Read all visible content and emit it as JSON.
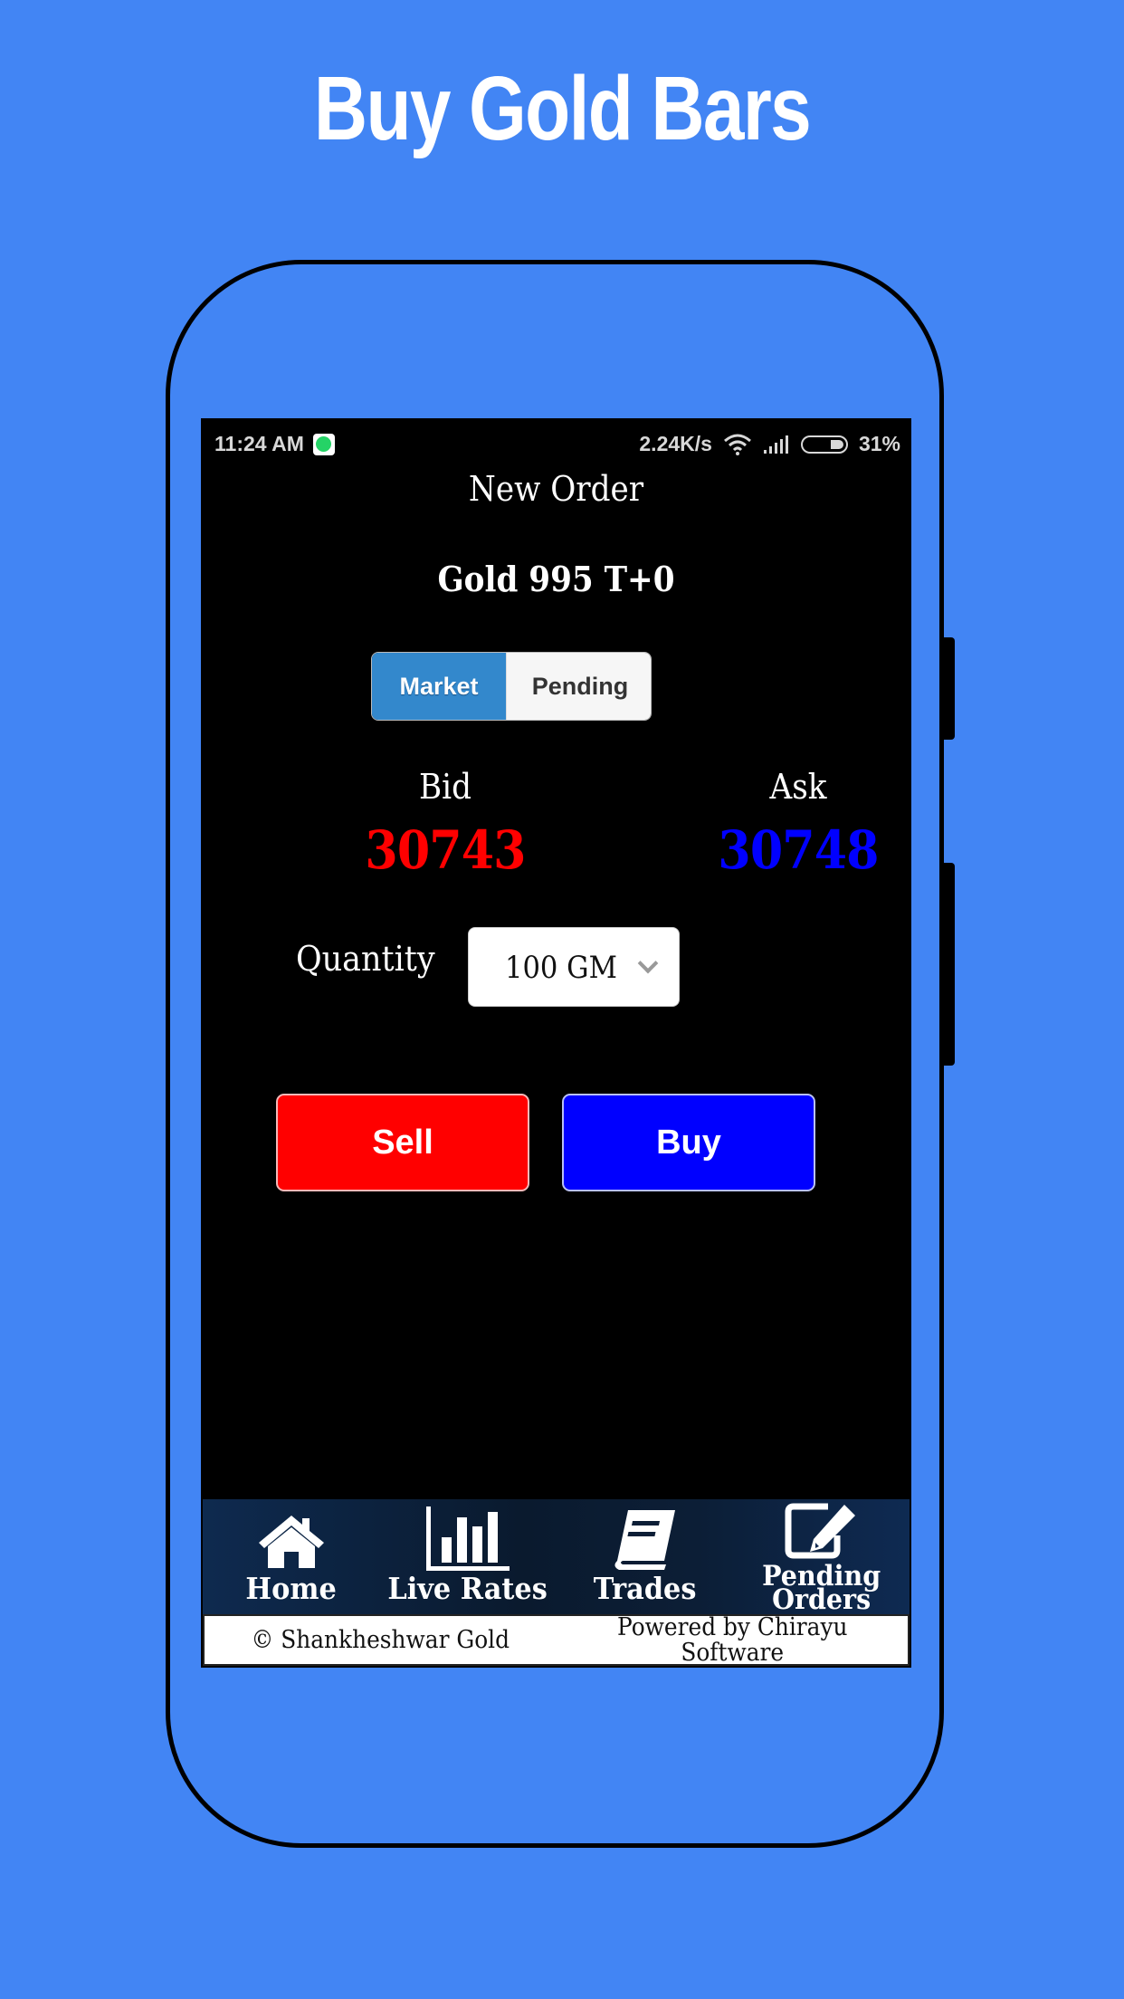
{
  "promo": {
    "title": "Buy Gold Bars"
  },
  "status_bar": {
    "time": "11:24 AM",
    "notification_icon": "whatsapp-icon",
    "network_speed": "2.24K/s",
    "wifi_icon": "wifi-icon",
    "signal_icon": "signal-icon",
    "battery_percent": "31%"
  },
  "header": {
    "title": "New Order"
  },
  "order": {
    "instrument": "Gold 995 T+0",
    "order_type_tabs": [
      {
        "label": "Market",
        "selected": true
      },
      {
        "label": "Pending",
        "selected": false
      }
    ],
    "bid": {
      "label": "Bid",
      "value": "30743",
      "color": "#ff0000"
    },
    "ask": {
      "label": "Ask",
      "value": "30748",
      "color": "#0000ff"
    },
    "quantity": {
      "label": "Quantity",
      "selected": "100 GM"
    },
    "sell_label": "Sell",
    "buy_label": "Buy",
    "sell_color": "#ff0000",
    "buy_color": "#0000ff"
  },
  "bottom_nav": [
    {
      "label": "Home",
      "icon": "home-icon"
    },
    {
      "label": "Live Rates",
      "icon": "bar-chart-icon"
    },
    {
      "label": "Trades",
      "icon": "book-icon"
    },
    {
      "label": "Pending Orders",
      "icon": "edit-icon"
    }
  ],
  "footer": {
    "copyright": "© Shankheshwar Gold",
    "powered_by": "Powered by Chirayu Software"
  },
  "colors": {
    "background": "#4285f4",
    "toggle_active": "#3388cc"
  }
}
